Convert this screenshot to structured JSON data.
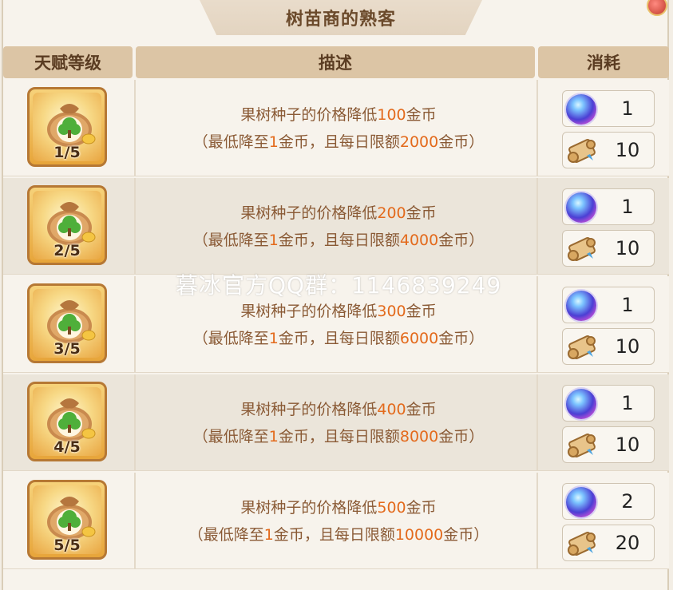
{
  "window": {
    "title": "树苗商的熟客"
  },
  "header": {
    "col_level": "天赋等级",
    "col_desc": "描述",
    "col_cost": "消耗"
  },
  "icons": {
    "talent": "seed-bag-tree-icon",
    "cost1": "crystal-orb-icon",
    "cost2": "scroll-icon"
  },
  "colors": {
    "highlight": "#e36a1c",
    "text": "#8a5a35",
    "header_bg": "#dcc5a5"
  },
  "rows": [
    {
      "level": "1/5",
      "line1_a": "果树种子的价格降低",
      "line1_num": "100",
      "line1_b": "金币",
      "line2_a": "（最低降至",
      "line2_num1": "1",
      "line2_b": "金币，且每日限额",
      "line2_num2": "2000",
      "line2_c": "金币）",
      "cost1": "1",
      "cost2": "10"
    },
    {
      "level": "2/5",
      "line1_a": "果树种子的价格降低",
      "line1_num": "200",
      "line1_b": "金币",
      "line2_a": "（最低降至",
      "line2_num1": "1",
      "line2_b": "金币，且每日限额",
      "line2_num2": "4000",
      "line2_c": "金币）",
      "cost1": "1",
      "cost2": "10"
    },
    {
      "level": "3/5",
      "line1_a": "果树种子的价格降低",
      "line1_num": "300",
      "line1_b": "金币",
      "line2_a": "（最低降至",
      "line2_num1": "1",
      "line2_b": "金币，且每日限额",
      "line2_num2": "6000",
      "line2_c": "金币）",
      "cost1": "1",
      "cost2": "10"
    },
    {
      "level": "4/5",
      "line1_a": "果树种子的价格降低",
      "line1_num": "400",
      "line1_b": "金币",
      "line2_a": "（最低降至",
      "line2_num1": "1",
      "line2_b": "金币，且每日限额",
      "line2_num2": "8000",
      "line2_c": "金币）",
      "cost1": "1",
      "cost2": "10"
    },
    {
      "level": "5/5",
      "line1_a": "果树种子的价格降低",
      "line1_num": "500",
      "line1_b": "金币",
      "line2_a": "（最低降至",
      "line2_num1": "1",
      "line2_b": "金币，且每日限额",
      "line2_num2": "10000",
      "line2_c": "金币）",
      "cost1": "2",
      "cost2": "20"
    }
  ],
  "watermark": "暮冰官方QQ群：1146839249"
}
